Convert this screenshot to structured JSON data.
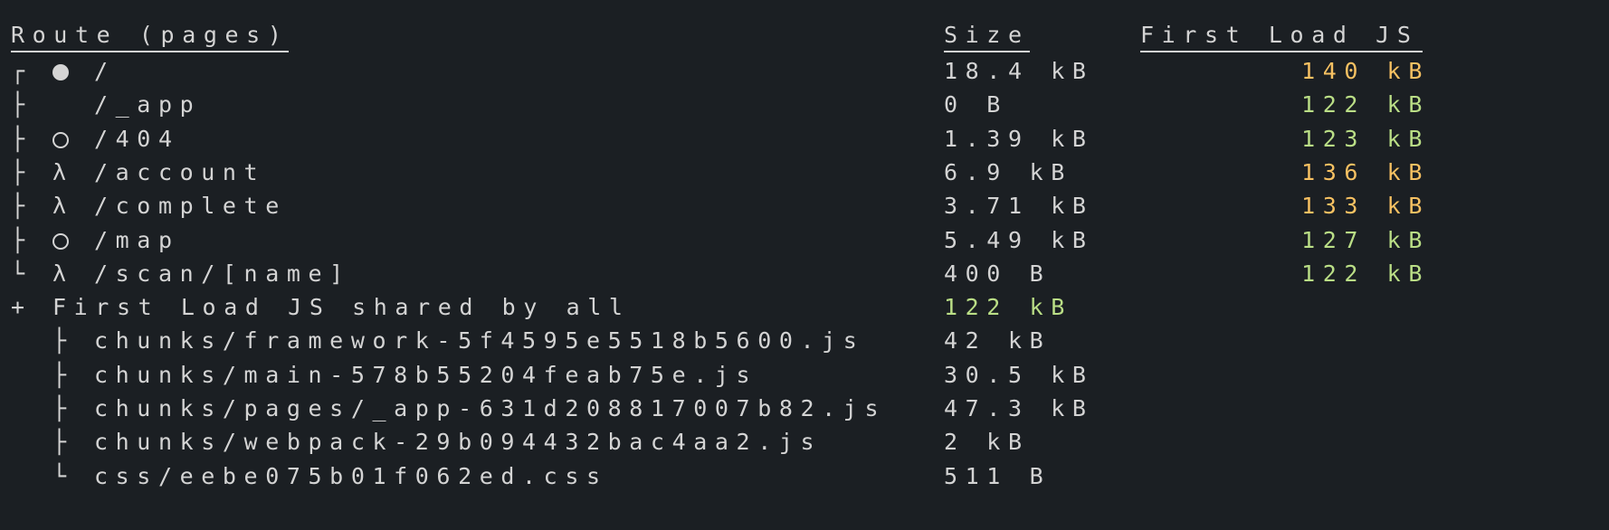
{
  "headers": {
    "route": "Route (pages)",
    "size": "Size",
    "first_load": "First Load JS"
  },
  "routes": [
    {
      "tree": "┌",
      "symbol": "filled-circle",
      "path": "/",
      "size": "18.4 kB",
      "first_load": "140 kB",
      "color": "yellow"
    },
    {
      "tree": "├",
      "symbol": "none",
      "path": "/_app",
      "size": "0 B",
      "first_load": "122 kB",
      "color": "green"
    },
    {
      "tree": "├",
      "symbol": "hollow-circle",
      "path": "/404",
      "size": "1.39 kB",
      "first_load": "123 kB",
      "color": "green"
    },
    {
      "tree": "├",
      "symbol": "lambda",
      "path": "/account",
      "size": "6.9 kB",
      "first_load": "136 kB",
      "color": "yellow"
    },
    {
      "tree": "├",
      "symbol": "lambda",
      "path": "/complete",
      "size": "3.71 kB",
      "first_load": "133 kB",
      "color": "yellow"
    },
    {
      "tree": "├",
      "symbol": "hollow-circle",
      "path": "/map",
      "size": "5.49 kB",
      "first_load": "127 kB",
      "color": "green"
    },
    {
      "tree": "└",
      "symbol": "lambda",
      "path": "/scan/[name]",
      "size": "400 B",
      "first_load": "122 kB",
      "color": "green"
    }
  ],
  "lambda_glyph": "λ",
  "shared": {
    "prefix": "+",
    "label": "First Load JS shared by all",
    "size": "122 kB"
  },
  "chunks": [
    {
      "tree": "├",
      "name": "chunks/framework-5f4595e5518b5600.js",
      "size": "42 kB"
    },
    {
      "tree": "├",
      "name": "chunks/main-578b55204feab75e.js",
      "size": "30.5 kB"
    },
    {
      "tree": "├",
      "name": "chunks/pages/_app-631d208817007b82.js",
      "size": "47.3 kB"
    },
    {
      "tree": "├",
      "name": "chunks/webpack-29b094432bac4aa2.js",
      "size": "2 kB"
    },
    {
      "tree": "└",
      "name": "css/eebe075b01f062ed.css",
      "size": "511 B"
    }
  ],
  "colors": {
    "background": "#1b1f23",
    "text": "#d4d4d4",
    "yellow": "#f7c162",
    "green": "#bade86"
  }
}
